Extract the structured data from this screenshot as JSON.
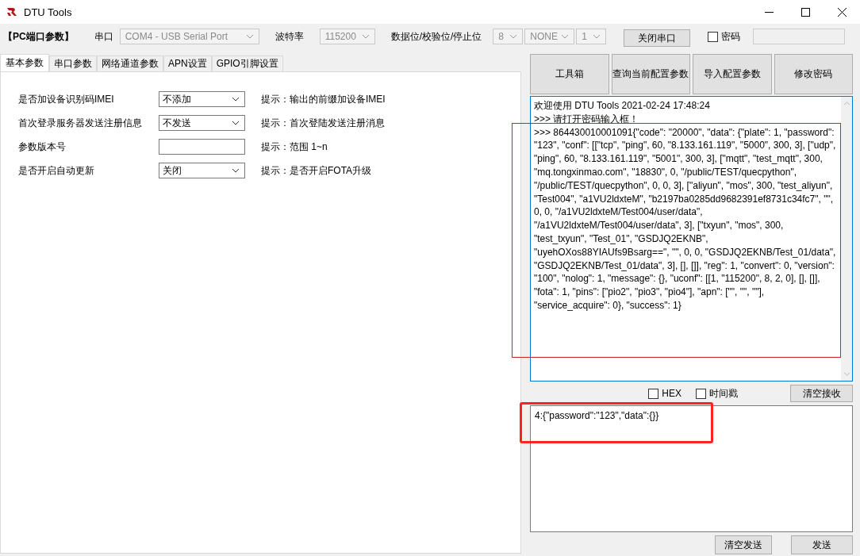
{
  "window": {
    "title": "DTU Tools"
  },
  "port_bar": {
    "title": "【PC端口参数】",
    "port": {
      "label": "串口",
      "value": "COM4 - USB Serial Port"
    },
    "baud": {
      "label": "波特率",
      "value": "115200"
    },
    "frame": {
      "label": "数据位/校验位/停止位",
      "values": [
        "8",
        "NONE",
        "1"
      ]
    },
    "close_button": "关闭串口",
    "password": {
      "label": "密码",
      "checked": false
    }
  },
  "tabs": [
    {
      "label": "基本参数",
      "selected": true
    },
    {
      "label": "串口参数",
      "selected": false
    },
    {
      "label": "网络通道参数",
      "selected": false
    },
    {
      "label": "APN设置",
      "selected": false
    },
    {
      "label": "GPIO引脚设置",
      "selected": false
    }
  ],
  "params": [
    {
      "kind": "select",
      "label": "是否加设备识别码IMEI",
      "value": "不添加",
      "hint": "提示：输出的前缀加设备IMEI"
    },
    {
      "kind": "select",
      "label": "首次登录服务器发送注册信息",
      "value": "不发送",
      "hint": "提示：首次登陆发送注册消息"
    },
    {
      "kind": "input",
      "label": "参数版本号",
      "hint": "提示：范围 1~n"
    },
    {
      "kind": "select",
      "label": "是否开启自动更新",
      "value": "关闭",
      "hint": "提示：是否开启FOTA升级"
    }
  ],
  "actions": [
    "工具箱",
    "查询当前配置参数",
    "导入配置参数",
    "修改密码"
  ],
  "receive": {
    "lines": [
      "欢迎使用 DTU Tools 2021-02-24 17:48:24",
      ">>> 请打开密码输入框！",
      ">>> 864430010001091{\"code\": \"20000\", \"data\": {\"plate\": 1, \"password\": \"123\", \"conf\": [[\"tcp\", \"ping\", 60, \"8.133.161.119\", \"5000\", 300, 3], [\"udp\", \"ping\", 60, \"8.133.161.119\", \"5001\", 300, 3], [\"mqtt\", \"test_mqtt\", 300, \"mq.tongxinmao.com\", \"18830\", 0, \"/public/TEST/quecpython\", \"/public/TEST/quecpython\", 0, 0, 3], [\"aliyun\", \"mos\", 300, \"test_aliyun\", \"Test004\", \"a1VU2ldxteM\", \"b2197ba0285dd9682391ef8731c34fc7\", \"\", 0, 0, \"/a1VU2ldxteM/Test004/user/data\", \"/a1VU2ldxteM/Test004/user/data\", 3], [\"txyun\", \"mos\", 300, \"test_txyun\", \"Test_01\", \"GSDJQ2EKNB\", \"uyehOXos88YIAUfs9Bsarg==\", \"\", 0, 0, \"GSDJQ2EKNB/Test_01/data\", \"GSDJQ2EKNB/Test_01/data\", 3], [], []], \"reg\": 1, \"convert\": 0, \"version\": \"100\", \"nolog\": 1, \"message\": {}, \"uconf\": [[1, \"115200\", 8, 2, 0], [], []], \"fota\": 1, \"pins\": [\"pio2\", \"pio3\", \"pio4\"], \"apn\": [\"\", \"\", \"\"], \"service_acquire\": 0}, \"success\": 1}"
    ],
    "options": [
      {
        "label": "HEX",
        "checked": false
      },
      {
        "label": "时间戳",
        "checked": false
      }
    ],
    "clear_button": "清空接收",
    "highlighted": true
  },
  "send": {
    "value": "4:{\"password\":\"123\",\"data\":{}}",
    "buttons": [
      "清空发送",
      "发送"
    ],
    "highlighted": true
  }
}
